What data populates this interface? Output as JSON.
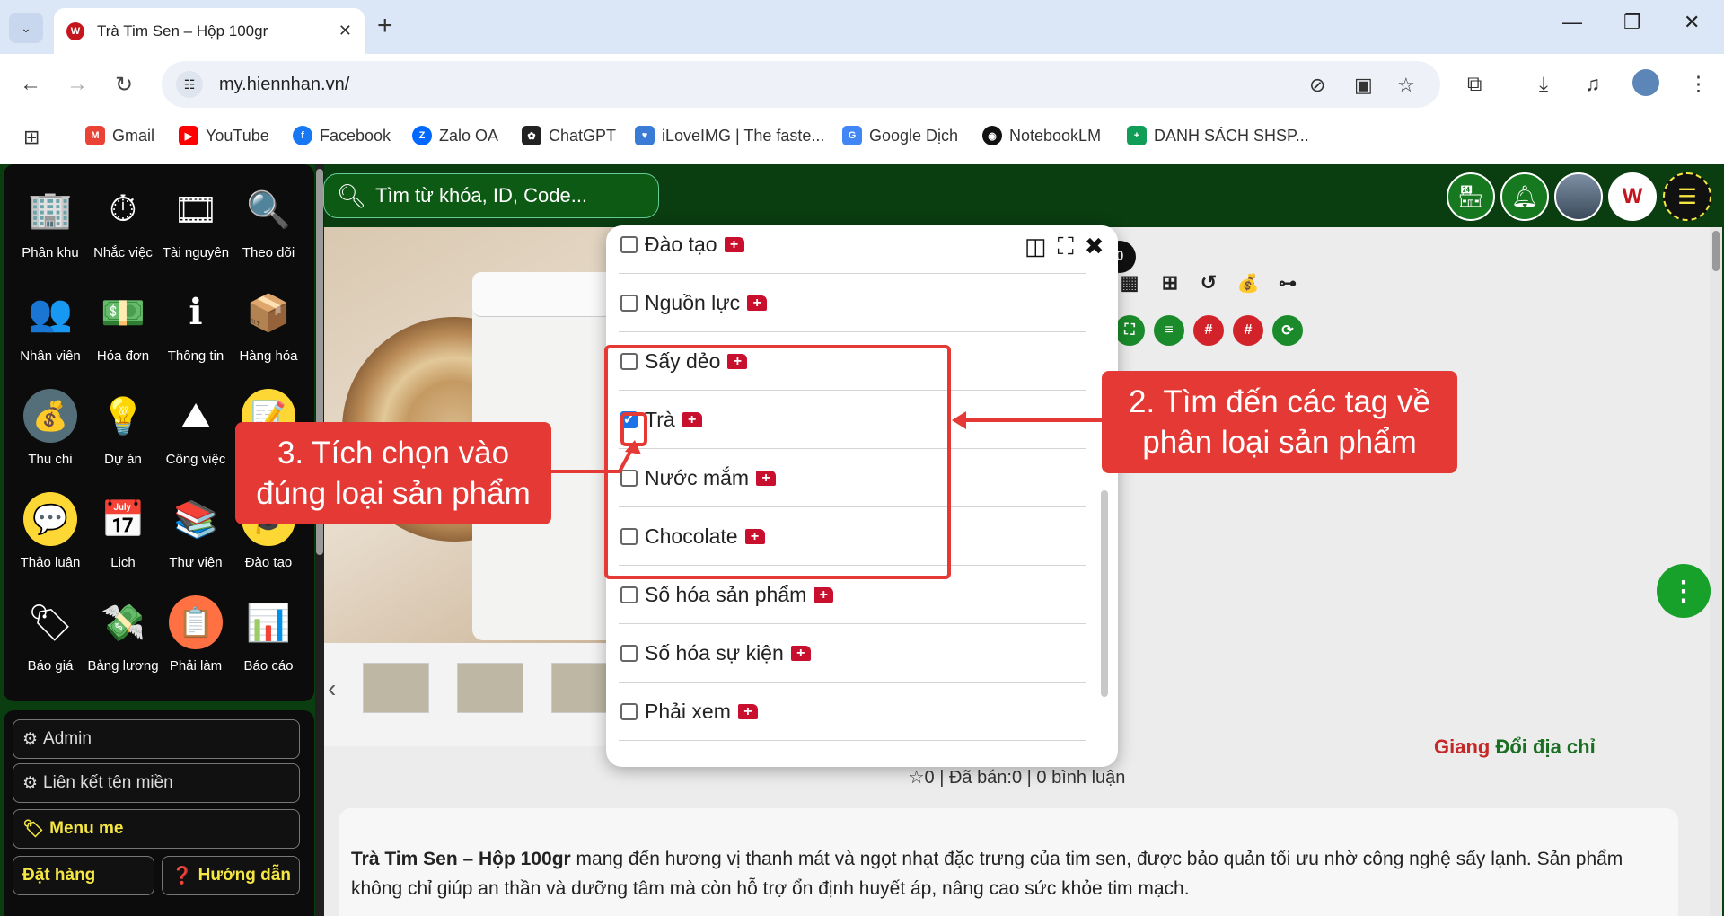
{
  "browser": {
    "tab_title": "Trà Tim Sen – Hộp 100gr",
    "url": "my.hiennhan.vn/",
    "bookmarks": [
      {
        "label": "Gmail",
        "color": "#ea4335",
        "glyph": "M"
      },
      {
        "label": "YouTube",
        "color": "#ff0000",
        "glyph": "▶"
      },
      {
        "label": "Facebook",
        "color": "#1877f2",
        "glyph": "f"
      },
      {
        "label": "Zalo OA",
        "color": "#0068ff",
        "glyph": "Z"
      },
      {
        "label": "ChatGPT",
        "color": "#222222",
        "glyph": "✿"
      },
      {
        "label": "iLoveIMG | The faste...",
        "color": "#3a7bd5",
        "glyph": "♥"
      },
      {
        "label": "Google Dịch",
        "color": "#4285f4",
        "glyph": "G"
      },
      {
        "label": "NotebookLM",
        "color": "#111111",
        "glyph": "◉"
      },
      {
        "label": "DANH SÁCH SHSP...",
        "color": "#0f9d58",
        "glyph": "+"
      }
    ]
  },
  "search": {
    "placeholder": "Tìm từ khóa, ID, Code..."
  },
  "apps": [
    {
      "label": "Phân khu",
      "icon": "🏢"
    },
    {
      "label": "Nhắc việc",
      "icon": "⏱"
    },
    {
      "label": "Tài nguyên",
      "icon": "🎞"
    },
    {
      "label": "Theo dõi",
      "icon": "🔍"
    },
    {
      "label": "Nhân viên",
      "icon": "👥"
    },
    {
      "label": "Hóa đơn",
      "icon": "💵"
    },
    {
      "label": "Thông tin",
      "icon": "ℹ"
    },
    {
      "label": "Hàng hóa",
      "icon": "📦"
    },
    {
      "label": "Thu chi",
      "icon": "💰"
    },
    {
      "label": "Dự án",
      "icon": "💡"
    },
    {
      "label": "Công việc",
      "icon": "⛰"
    },
    {
      "label": "Ghi chú",
      "icon": "📝"
    },
    {
      "label": "Thảo luận",
      "icon": "💬"
    },
    {
      "label": "Lịch",
      "icon": "📅"
    },
    {
      "label": "Thư viện",
      "icon": "📚"
    },
    {
      "label": "Đào tạo",
      "icon": "🎓"
    },
    {
      "label": "Báo giá",
      "icon": "🏷"
    },
    {
      "label": "Bảng lương",
      "icon": "💸"
    },
    {
      "label": "Phải làm",
      "icon": "📋"
    },
    {
      "label": "Báo cáo",
      "icon": "📊"
    }
  ],
  "left_menu": {
    "admin": "Admin",
    "domain_link": "Liên kết tên miền",
    "menu_me": "Menu me",
    "order": "Đặt hàng",
    "guide": "Hướng dẫn"
  },
  "product": {
    "cart_count": "0",
    "rating_line": "☆0 | Đã bán:0 | 0 bình luận",
    "address_prefix": "Giang",
    "address_link": "Đổi địa chỉ",
    "description_bold": "Trà Tim Sen – Hộp 100gr",
    "description_rest": " mang đến hương vị thanh mát và ngọt nhạt đặc trưng của tim sen, được bảo quản tối ưu nhờ công nghệ sấy lạnh. Sản phẩm không chỉ giúp an thần và dưỡng tâm mà còn hỗ trợ ổn định huyết áp, nâng cao sức khỏe tim mạch."
  },
  "tag_options": [
    {
      "label": "Đào tạo",
      "checked": false
    },
    {
      "label": "Nguồn lực",
      "checked": false
    },
    {
      "label": "Sấy dẻo",
      "checked": false
    },
    {
      "label": "Trà",
      "checked": true
    },
    {
      "label": "Nước mắm",
      "checked": false
    },
    {
      "label": "Chocolate",
      "checked": false
    },
    {
      "label": "Số hóa sản phẩm",
      "checked": false
    },
    {
      "label": "Số hóa sự kiện",
      "checked": false
    },
    {
      "label": "Phải xem",
      "checked": false
    }
  ],
  "annotations": {
    "step2_line1": "2. Tìm đến các tag về",
    "step2_line2": "phân loại sản phẩm",
    "step3_line1": "3. Tích chọn vào",
    "step3_line2": "đúng loại sản phẩm"
  },
  "colors": {
    "accent_red": "#e53935",
    "page_green": "#0a3d10",
    "menu_yellow": "#f5e642"
  }
}
